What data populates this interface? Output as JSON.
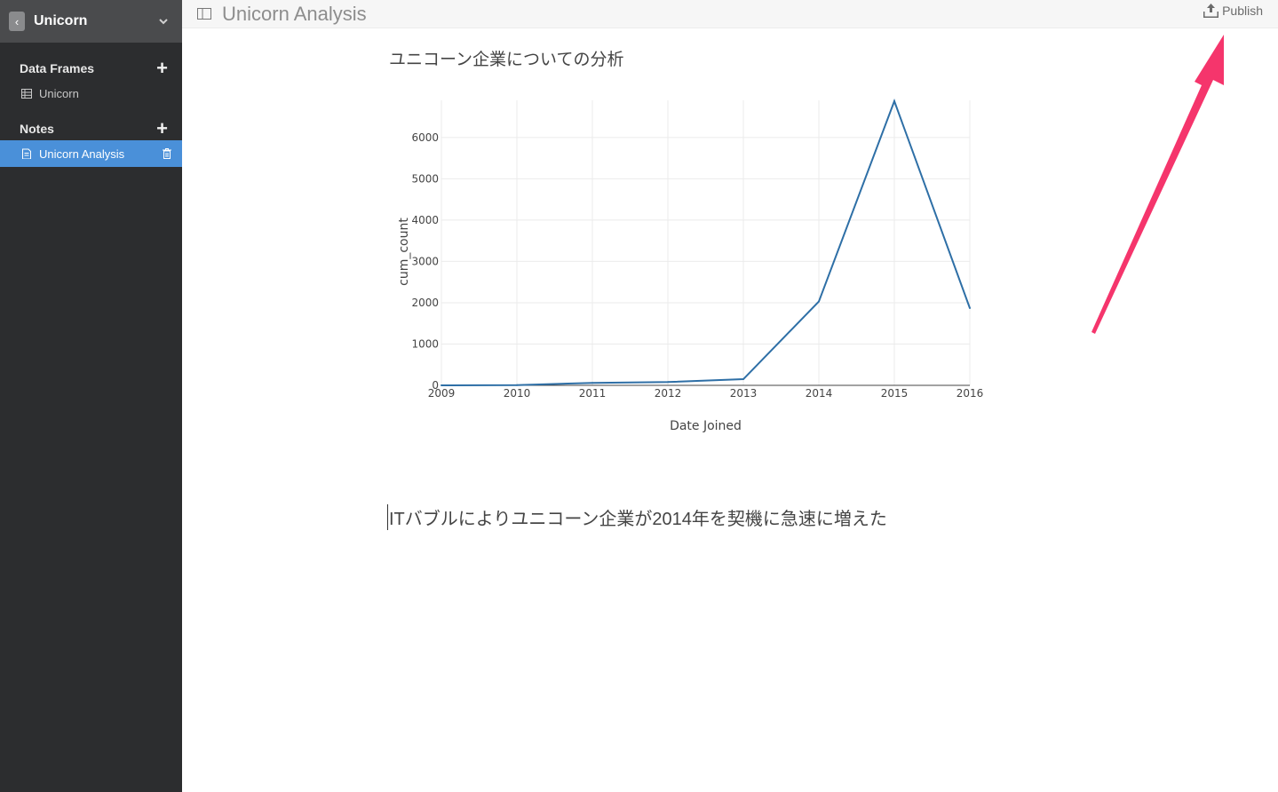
{
  "sidebar": {
    "project_name": "Unicorn",
    "data_frames": {
      "title": "Data Frames",
      "items": [
        {
          "label": "Unicorn"
        }
      ]
    },
    "notes": {
      "title": "Notes",
      "items": [
        {
          "label": "Unicorn Analysis",
          "active": true
        }
      ]
    }
  },
  "topbar": {
    "title": "Unicorn Analysis",
    "publish_label": "Publish"
  },
  "note": {
    "chart_title": "ユニコーン企業についての分析",
    "text": "ITバブルによりユニコーン企業が2014年を契機に急速に増えた"
  },
  "colors": {
    "accent": "#4a90d9",
    "line": "#2e6fa6",
    "arrow": "#f5356c"
  },
  "chart_data": {
    "type": "line",
    "xlabel": "Date Joined",
    "ylabel": "cum_count",
    "x": [
      2009,
      2010,
      2011,
      2012,
      2013,
      2014,
      2015,
      2016
    ],
    "values": [
      0,
      5,
      60,
      80,
      150,
      2030,
      6880,
      1870
    ],
    "xticks": [
      "2009",
      "2010",
      "2011",
      "2012",
      "2013",
      "2014",
      "2015",
      "2016"
    ],
    "yticks": [
      "0",
      "1000",
      "2000",
      "3000",
      "4000",
      "5000",
      "6000"
    ],
    "xlim": [
      2009,
      2016
    ],
    "ylim": [
      0,
      6900
    ],
    "grid": true
  }
}
